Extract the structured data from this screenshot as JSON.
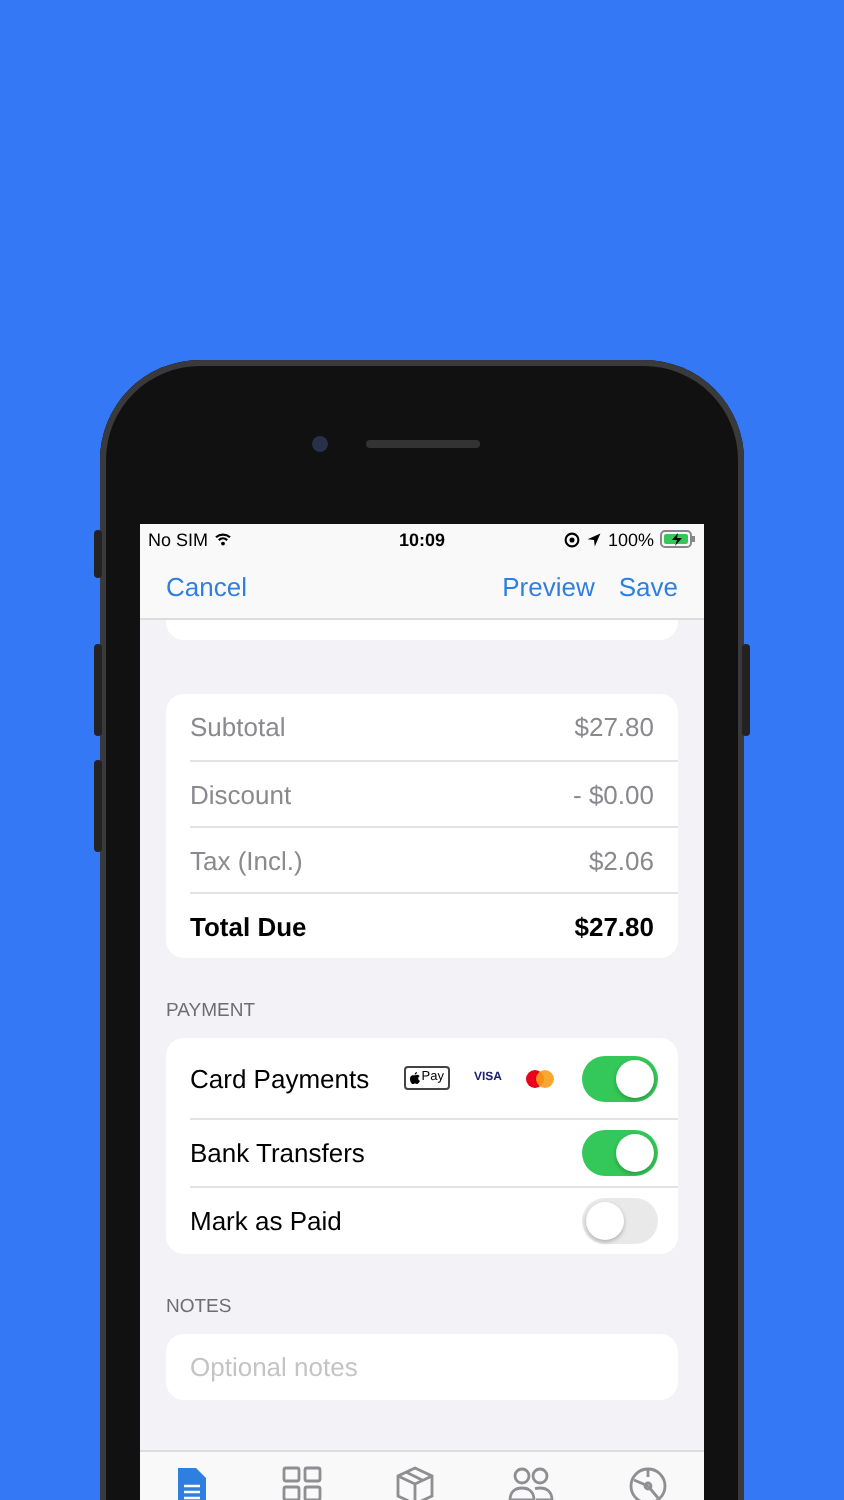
{
  "status_bar": {
    "carrier": "No SIM",
    "time": "10:09",
    "battery": "100%"
  },
  "nav": {
    "cancel": "Cancel",
    "actions": [
      "Preview",
      "Save"
    ]
  },
  "totals": [
    {
      "label": "Subtotal",
      "value": "$27.80",
      "kind": "line"
    },
    {
      "label": "Discount",
      "value": "- $0.00",
      "kind": "line"
    },
    {
      "label": "Tax (Incl.)",
      "value": "$2.06",
      "kind": "line"
    },
    {
      "label": "Total Due",
      "value": "$27.80",
      "kind": "total"
    }
  ],
  "payment": {
    "header": "PAYMENT",
    "rows": [
      {
        "label": "Card Payments",
        "on": true,
        "badges": [
          {
            "kind": "applepay",
            "text": "Pay"
          },
          {
            "kind": "visa",
            "text": "VISA"
          },
          {
            "kind": "mastercard"
          }
        ]
      },
      {
        "label": "Bank Transfers",
        "on": true
      },
      {
        "label": "Mark as Paid",
        "on": false
      }
    ]
  },
  "notes": {
    "header": "NOTES",
    "placeholder": "Optional notes"
  },
  "tab_bar": [
    {
      "kind": "document",
      "selected": true
    },
    {
      "kind": "grid",
      "selected": false
    },
    {
      "kind": "box",
      "selected": false
    },
    {
      "kind": "people",
      "selected": false
    },
    {
      "kind": "dial",
      "selected": false
    }
  ]
}
